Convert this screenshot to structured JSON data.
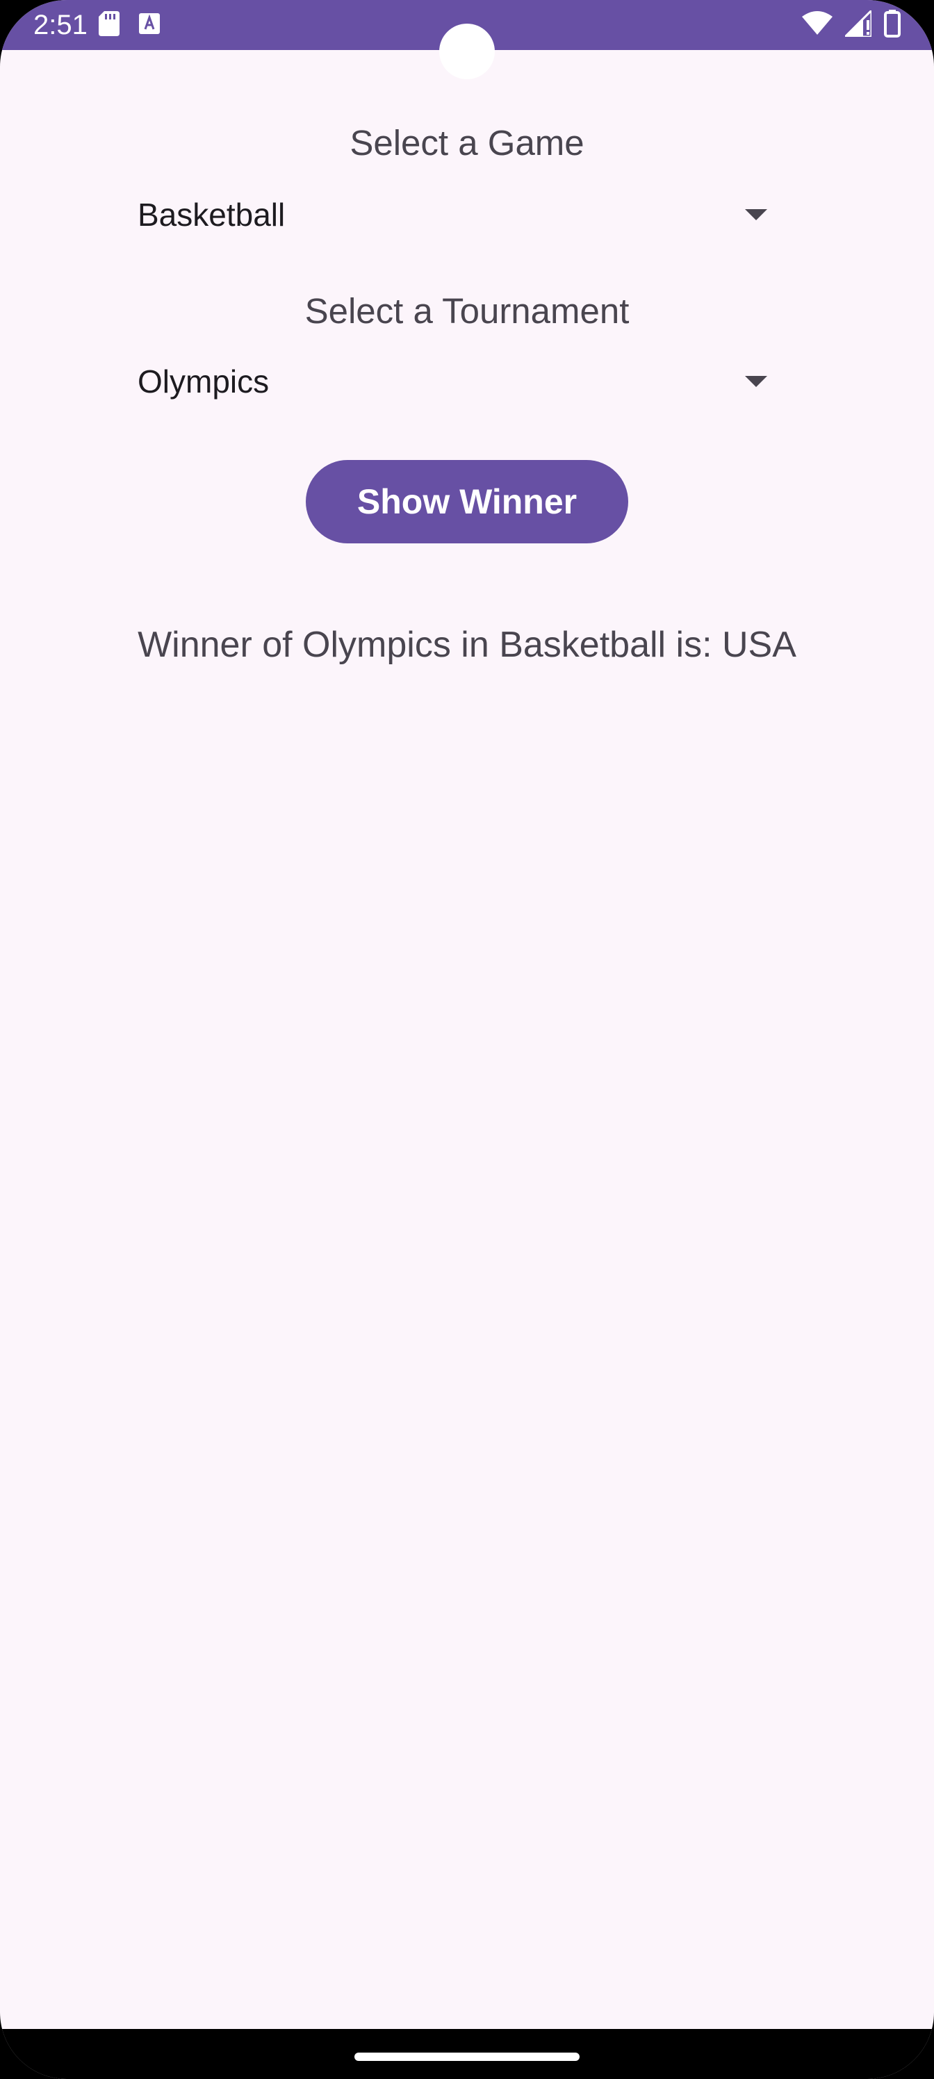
{
  "status_bar": {
    "time": "2:51",
    "left_icons": [
      "sd-card-icon",
      "text-notification-icon"
    ],
    "right_icons": [
      "wifi-icon",
      "cellular-signal-icon",
      "battery-icon"
    ],
    "background_color": "#6750A4"
  },
  "form": {
    "game_label": "Select a Game",
    "game_selected": "Basketball",
    "tournament_label": "Select a Tournament",
    "tournament_selected": "Olympics",
    "show_winner_label": "Show Winner"
  },
  "result": {
    "text": "Winner of Olympics in Basketball is: USA"
  },
  "colors": {
    "primary": "#6750A4",
    "background": "#FCF5FB",
    "text": "#49454F"
  }
}
